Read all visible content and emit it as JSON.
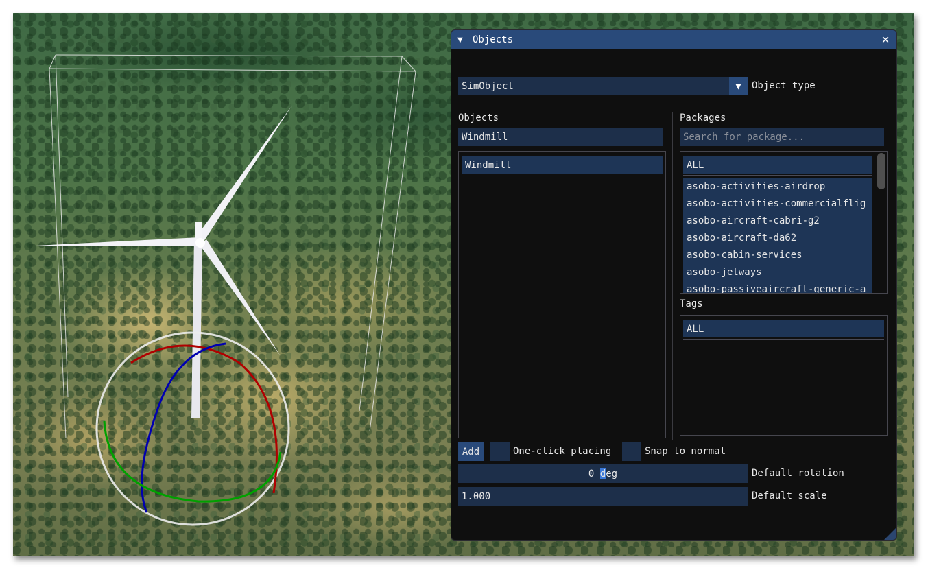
{
  "window": {
    "title": "Objects",
    "collapse_icon": "▼",
    "close_icon": "✕"
  },
  "object_type": {
    "value": "SimObject",
    "arrow": "▼",
    "label": "Object type"
  },
  "objects": {
    "header": "Objects",
    "filter_value": "Windmill",
    "items": [
      "Windmill"
    ]
  },
  "packages": {
    "header": "Packages",
    "search_placeholder": "Search for package...",
    "all_label": "ALL",
    "items": [
      "asobo-activities-airdrop",
      "asobo-activities-commercialflig",
      "asobo-aircraft-cabri-g2",
      "asobo-aircraft-da62",
      "asobo-cabin-services",
      "asobo-jetways",
      "asobo-passiveaircraft-generic-a"
    ]
  },
  "tags": {
    "header": "Tags",
    "items": [
      "ALL"
    ]
  },
  "controls": {
    "add_label": "Add",
    "one_click_placing_label": "One-click placing",
    "one_click_placing_checked": false,
    "snap_to_normal_label": "Snap to normal",
    "snap_to_normal_checked": false,
    "rotation_value": "0",
    "rotation_unit_selected": "d",
    "rotation_unit_rest": "eg",
    "rotation_label": "Default rotation",
    "scale_value": "1.000",
    "scale_label": "Default scale"
  },
  "scene": {
    "gizmo_colors": {
      "x": "#b00000",
      "y": "#00a000",
      "z": "#0000b0",
      "ring": "#e8e8e8"
    }
  }
}
